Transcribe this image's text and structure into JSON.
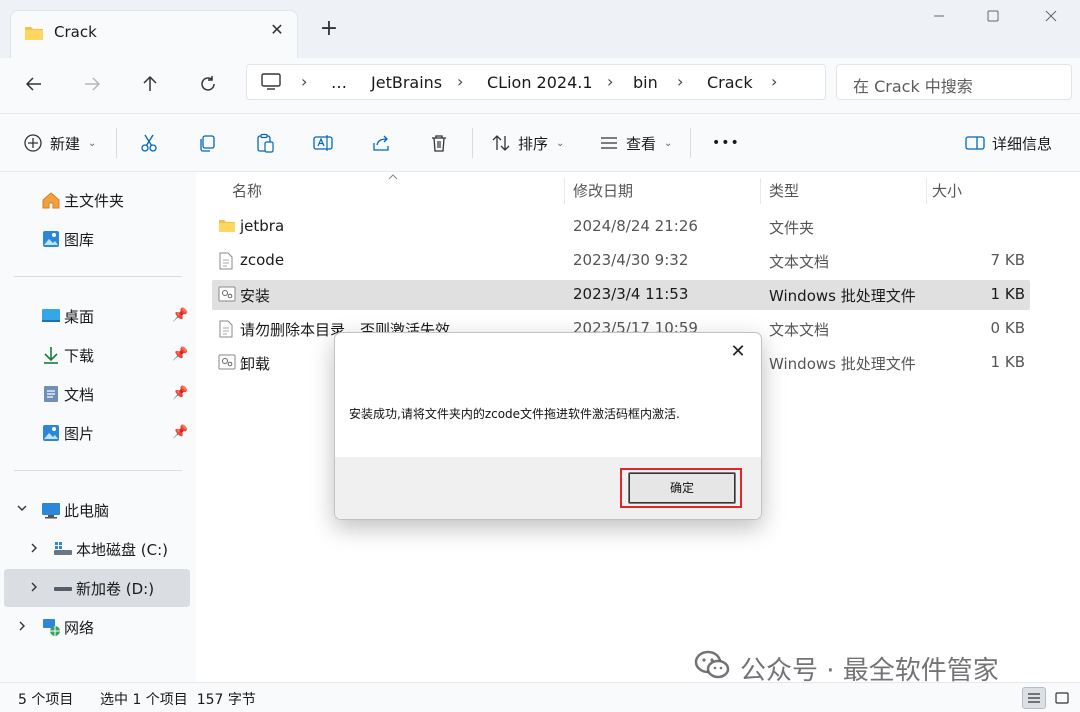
{
  "window": {
    "tab_title": "Crack",
    "new_tab": "+",
    "tab_close": "✕"
  },
  "nav": {
    "breadcrumb": [
      "…",
      "JetBrains",
      "CLion 2024.1",
      "bin",
      "Crack"
    ],
    "search_placeholder": "在 Crack 中搜索"
  },
  "commands": {
    "new": "新建",
    "sort": "排序",
    "view": "查看",
    "more": "•••",
    "details": "详细信息"
  },
  "sidebar": {
    "home": "主文件夹",
    "gallery": "图库",
    "pinned": [
      "桌面",
      "下载",
      "文档",
      "图片"
    ],
    "this_pc": "此电脑",
    "drive_c": "本地磁盘 (C:)",
    "drive_d": "新加卷 (D:)",
    "network": "网络"
  },
  "columns": {
    "name": "名称",
    "modified": "修改日期",
    "type": "类型",
    "size": "大小"
  },
  "files": [
    {
      "name": "jetbra",
      "modified": "2024/8/24 21:26",
      "type": "文件夹",
      "size": "",
      "icon": "folder-icon"
    },
    {
      "name": "zcode",
      "modified": "2023/4/30 9:32",
      "type": "文本文档",
      "size": "7 KB",
      "icon": "text-file-icon"
    },
    {
      "name": "安装",
      "modified": "2023/3/4 11:53",
      "type": "Windows 批处理文件",
      "size": "1 KB",
      "icon": "batch-file-icon"
    },
    {
      "name": "请勿删除本目录，否则激活失效",
      "modified": "2023/5/17 10:59",
      "type": "文本文档",
      "size": "0 KB",
      "icon": "text-file-icon"
    },
    {
      "name": "卸载",
      "modified": "",
      "type": "Windows 批处理文件",
      "size": "1 KB",
      "icon": "batch-file-icon"
    }
  ],
  "dialog": {
    "message": "安装成功,请将文件夹内的zcode文件拖进软件激活码框内激活.",
    "ok": "确定",
    "close": "✕"
  },
  "status": {
    "item_count": "5 个项目",
    "selection": "选中 1 个项目  157 字节"
  },
  "watermark": {
    "text": "公众号 · 最全软件管家"
  },
  "colors": {
    "accent": "#0067c0",
    "highlight": "#e0262b",
    "folder": "#f5c342"
  }
}
